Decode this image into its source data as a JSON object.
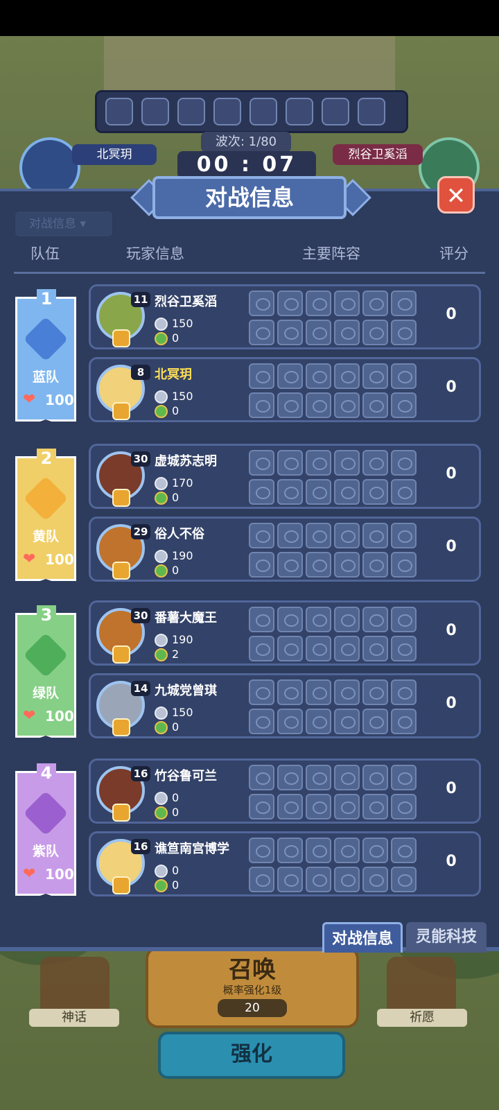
{
  "hud": {
    "wave_label": "波次: 1/80",
    "timer": "00 : 07",
    "left_player": "北冥玥",
    "right_player": "烈谷卫奚滔"
  },
  "modal": {
    "title": "对战信息",
    "close_symbol": "✕",
    "filter_label": "对战信息 ▾",
    "headers": {
      "team": "队伍",
      "player": "玩家信息",
      "lineup": "主要阵容",
      "score": "评分"
    }
  },
  "teams": [
    {
      "rank": "1",
      "name": "蓝队",
      "hp": "100",
      "color": "#7fb6ef",
      "emblem": "#4a7fd8",
      "players": [
        {
          "level": "11",
          "name": "烈谷卫奚滔",
          "coins": "150",
          "gems": "0",
          "score": "0",
          "self": false,
          "avatar": "#8aa64a"
        },
        {
          "level": "8",
          "name": "北冥玥",
          "coins": "150",
          "gems": "0",
          "score": "0",
          "self": true,
          "avatar": "#f1d27a"
        }
      ]
    },
    {
      "rank": "2",
      "name": "黄队",
      "hp": "100",
      "color": "#f0cf68",
      "emblem": "#f3b03a",
      "players": [
        {
          "level": "30",
          "name": "虚城苏志明",
          "coins": "170",
          "gems": "0",
          "score": "0",
          "self": false,
          "avatar": "#7a3b2a"
        },
        {
          "level": "29",
          "name": "俗人不俗",
          "coins": "190",
          "gems": "0",
          "score": "0",
          "self": false,
          "avatar": "#c0732c"
        }
      ]
    },
    {
      "rank": "3",
      "name": "绿队",
      "hp": "100",
      "color": "#86cf86",
      "emblem": "#4fae5a",
      "players": [
        {
          "level": "30",
          "name": "番薯大魔王",
          "coins": "190",
          "gems": "2",
          "score": "0",
          "self": false,
          "avatar": "#c0732c"
        },
        {
          "level": "14",
          "name": "九城党曾琪",
          "coins": "150",
          "gems": "0",
          "score": "0",
          "self": false,
          "avatar": "#9aa6b8"
        }
      ]
    },
    {
      "rank": "4",
      "name": "紫队",
      "hp": "100",
      "color": "#c89be8",
      "emblem": "#9b5fcf",
      "players": [
        {
          "level": "16",
          "name": "竹谷鲁可兰",
          "coins": "0",
          "gems": "0",
          "score": "0",
          "self": false,
          "avatar": "#7a3b2a"
        },
        {
          "level": "16",
          "name": "谯笪南宫博学",
          "coins": "0",
          "gems": "0",
          "score": "0",
          "self": false,
          "avatar": "#f1d27a"
        }
      ]
    }
  ],
  "tabs": {
    "battle_info": "对战信息",
    "psi_tech": "灵能科技"
  },
  "bottom": {
    "summon_title": "召唤",
    "summon_sub": "概率强化1级",
    "summon_cost": "20",
    "strengthen": "强化",
    "left_label": "神话",
    "right_label": "祈愿"
  },
  "icons": {
    "heart": "heart-icon",
    "coin": "silver-coin-icon",
    "gem": "green-gem-icon",
    "close": "close-icon"
  }
}
